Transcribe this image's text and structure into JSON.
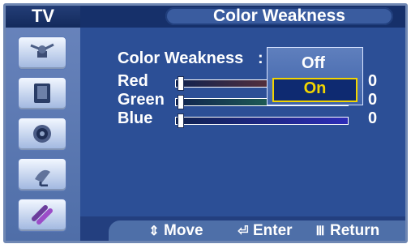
{
  "sidebar": {
    "title": "TV",
    "icons": [
      "antenna-icon",
      "speaker-icon",
      "disk-icon",
      "satellite-dish-icon",
      "tools-icon"
    ]
  },
  "header": {
    "title": "Color Weakness"
  },
  "menu": {
    "color_weakness_label": "Color Weakness",
    "colon": ":",
    "rows": [
      {
        "label": "Red",
        "value": "0",
        "level_fraction": 0.02
      },
      {
        "label": "Green",
        "value": "0",
        "level_fraction": 0.02
      },
      {
        "label": "Blue",
        "value": "0",
        "level_fraction": 0.02
      }
    ],
    "options": [
      {
        "label": "Off",
        "selected": false
      },
      {
        "label": "On",
        "selected": true
      }
    ]
  },
  "footer": {
    "move_label": "Move",
    "enter_label": "Enter",
    "return_label": "Return",
    "move_icon": "up-down-arrow-icon",
    "enter_icon": "enter-icon",
    "return_icon": "return-icon"
  },
  "colors": {
    "accent_yellow": "#f2d500",
    "panel_blue": "#2c4f96"
  }
}
